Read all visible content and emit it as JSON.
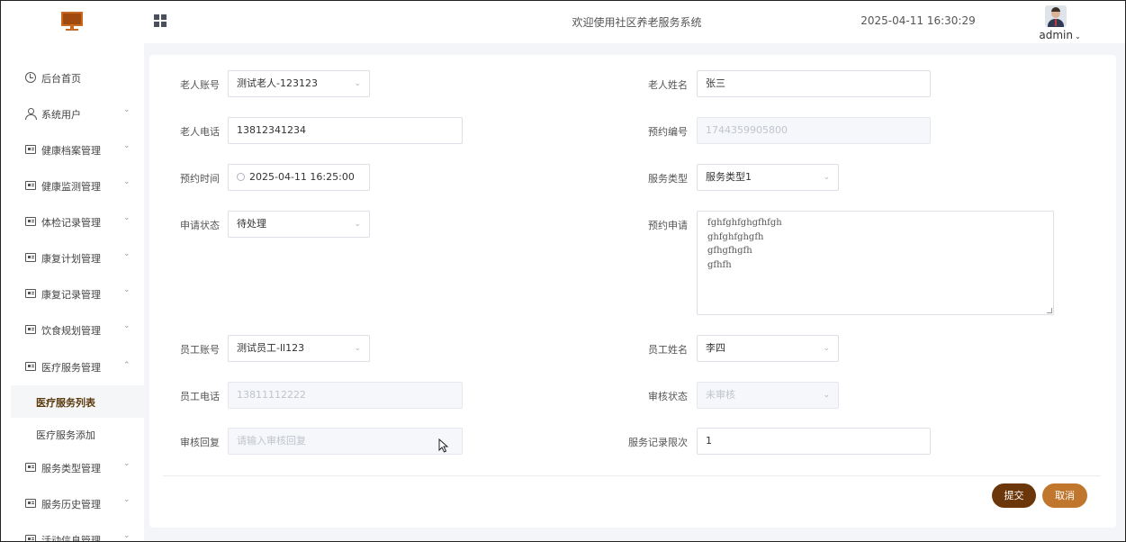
{
  "header": {
    "title": "欢迎使用社区养老服务系统",
    "datetime": "2025-04-11 16:30:29",
    "user": "admin"
  },
  "sidebar": {
    "items": [
      {
        "label": "后台首页",
        "icon": "clock-icon"
      },
      {
        "label": "系统用户",
        "icon": "user-icon"
      },
      {
        "label": "健康档案管理",
        "icon": "doc-icon"
      },
      {
        "label": "健康监测管理",
        "icon": "doc-icon"
      },
      {
        "label": "体检记录管理",
        "icon": "doc-icon"
      },
      {
        "label": "康复计划管理",
        "icon": "doc-icon"
      },
      {
        "label": "康复记录管理",
        "icon": "doc-icon"
      },
      {
        "label": "饮食规划管理",
        "icon": "doc-icon"
      },
      {
        "label": "医疗服务管理",
        "icon": "doc-icon"
      },
      {
        "label": "服务类型管理",
        "icon": "doc-icon"
      },
      {
        "label": "服务历史管理",
        "icon": "doc-icon"
      },
      {
        "label": "活动信息管理",
        "icon": "doc-icon"
      }
    ],
    "sub_items": [
      {
        "label": "医疗服务列表",
        "active": true
      },
      {
        "label": "医疗服务添加",
        "active": false
      }
    ]
  },
  "form": {
    "elder_account": {
      "label": "老人账号",
      "value": "测试老人-123123"
    },
    "elder_name": {
      "label": "老人姓名",
      "value": "张三"
    },
    "elder_phone": {
      "label": "老人电话",
      "value": "13812341234"
    },
    "booking_no": {
      "label": "预约编号",
      "value": "1744359905800"
    },
    "booking_time": {
      "label": "预约时间",
      "value": "2025-04-11 16:25:00"
    },
    "service_type": {
      "label": "服务类型",
      "value": "服务类型1"
    },
    "apply_status": {
      "label": "申请状态",
      "value": "待处理"
    },
    "booking_request": {
      "label": "预约申请",
      "lines": [
        "fghfghfghgfhfgh",
        "ghfghfghgfh",
        "gfhgfhgfh",
        "gfhfh"
      ]
    },
    "staff_account": {
      "label": "员工账号",
      "value": "测试员工-ll123"
    },
    "staff_name": {
      "label": "员工姓名",
      "value": "李四"
    },
    "staff_phone": {
      "label": "员工电话",
      "value": "13811112222"
    },
    "review_status": {
      "label": "审核状态",
      "value": "未审核"
    },
    "review_reply": {
      "label": "审核回复",
      "placeholder": "请输入审核回复"
    },
    "service_limit": {
      "label": "服务记录限次",
      "value": "1"
    }
  },
  "buttons": {
    "submit": "提交",
    "cancel": "取消"
  },
  "colors": {
    "submit": "#6b3609",
    "cancel": "#c0772d",
    "active_menu": "#5a3a0c"
  }
}
